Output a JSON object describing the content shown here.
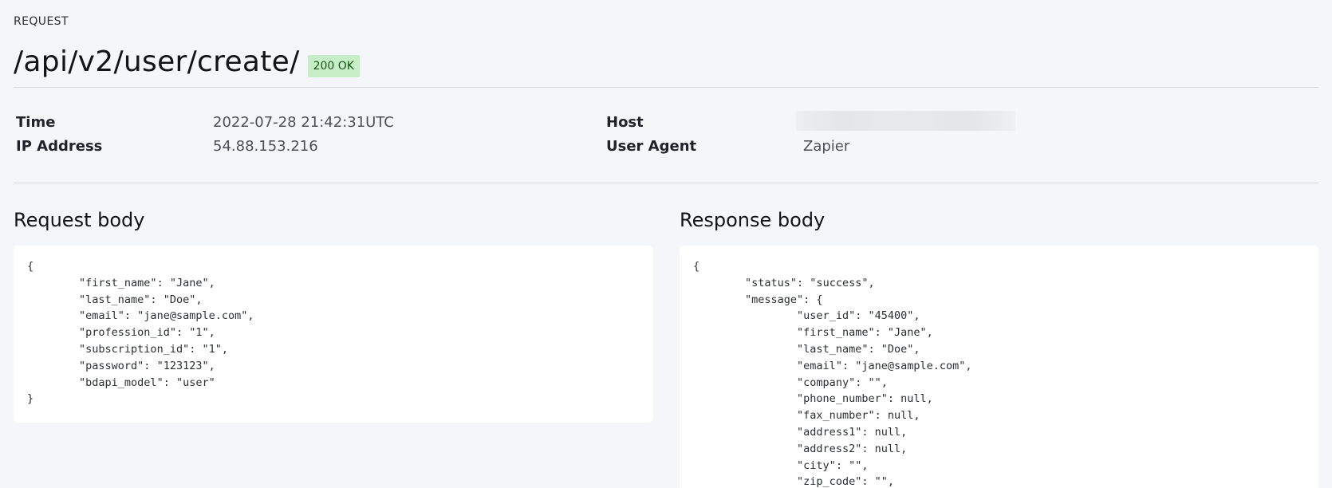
{
  "header": {
    "section_label": "REQUEST",
    "endpoint": "/api/v2/user/create/",
    "status": "200 OK",
    "status_color": "#c7efc7"
  },
  "meta": {
    "time_label": "Time",
    "time_value": "2022-07-28 21:42:31UTC",
    "ip_label": "IP Address",
    "ip_value": "54.88.153.216",
    "host_label": "Host",
    "user_agent_label": "User Agent",
    "user_agent_value": "Zapier"
  },
  "request_body": {
    "title": "Request body",
    "code": "{\n\t\"first_name\": \"Jane\",\n\t\"last_name\": \"Doe\",\n\t\"email\": \"jane@sample.com\",\n\t\"profession_id\": \"1\",\n\t\"subscription_id\": \"1\",\n\t\"password\": \"123123\",\n\t\"bdapi_model\": \"user\"\n}"
  },
  "response_body": {
    "title": "Response body",
    "code": "{\n\t\"status\": \"success\",\n\t\"message\": {\n\t\t\"user_id\": \"45400\",\n\t\t\"first_name\": \"Jane\",\n\t\t\"last_name\": \"Doe\",\n\t\t\"email\": \"jane@sample.com\",\n\t\t\"company\": \"\",\n\t\t\"phone_number\": null,\n\t\t\"fax_number\": null,\n\t\t\"address1\": null,\n\t\t\"address2\": null,\n\t\t\"city\": \"\",\n\t\t\"zip_code\": \"\","
  }
}
